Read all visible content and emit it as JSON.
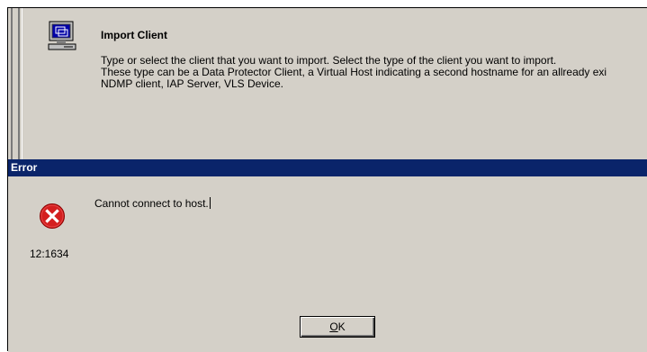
{
  "wizard": {
    "title": "Import Client",
    "description_lines": [
      "Type or select the client that you want to import. Select the type of the client you want to import.",
      "These type can be a Data Protector Client, a Virtual Host indicating a second hostname for an allready exi",
      "NDMP client, IAP Server, VLS Device."
    ],
    "icon": "computer-icon"
  },
  "error_dialog": {
    "title": "Error",
    "message": "Cannot connect to host.",
    "code": "12:1634",
    "icon": "error-icon",
    "ok_label_mnemonic": "O",
    "ok_label_rest": "K"
  },
  "colors": {
    "titlebar": "#0a246a",
    "dialog_face": "#d4d0c8",
    "error_red": "#d41f1f"
  }
}
